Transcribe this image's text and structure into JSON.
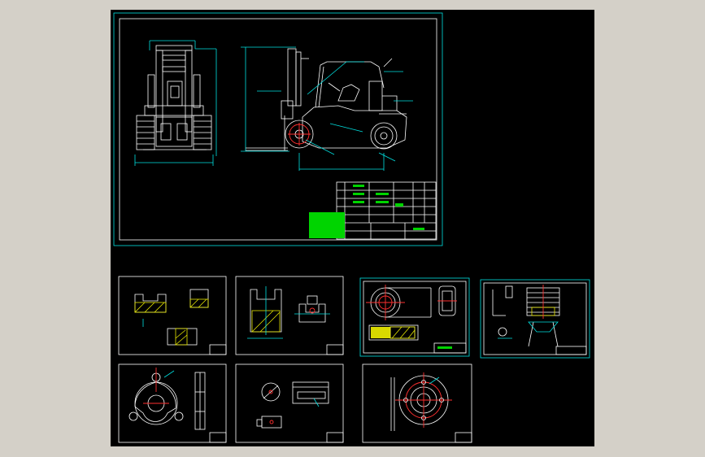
{
  "colors": {
    "background": "#000000",
    "frame": "#ffffff",
    "border": "#00e0e0",
    "dimension": "#00e0e0",
    "center": "#ff3030",
    "hatch": "#e8e800",
    "title_block": "#00d400",
    "surround": "#d4d0c8"
  }
}
